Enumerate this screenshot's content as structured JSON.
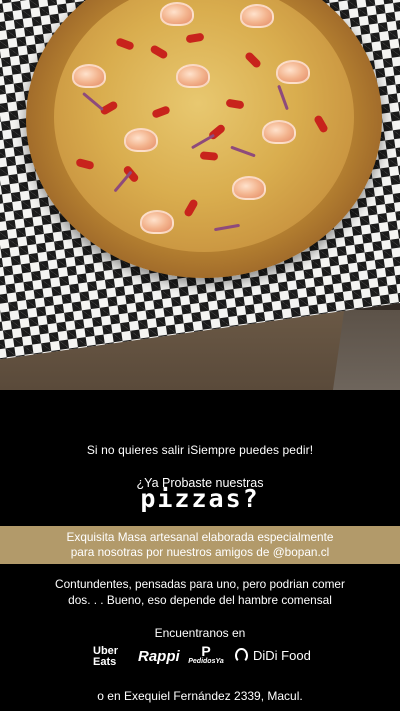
{
  "colors": {
    "background": "#000000",
    "band": "#b29a6a",
    "text": "#ffffff"
  },
  "photo": {
    "subject": "pizza-icon"
  },
  "text": {
    "line1": "Si no quieres salir iSiempre puedes pedir!",
    "line2": "¿Ya Probaste nuestras",
    "line3": "pizzas?",
    "band_line1": "Exquisita Masa artesanal elaborada especialmente",
    "band_line2": "para nosotras por nuestros amigos de @bopan.cl",
    "body_line1": "Contundentes, pensadas para uno, pero podrian comer",
    "body_line2": "dos. . . Bueno, eso depende del hambre comensal",
    "find_us": "Encuentranos en",
    "address": "o en Exequiel Fernández 2339, Macul."
  },
  "delivery": {
    "uber_line1": "Uber",
    "uber_line2": "Eats",
    "rappi": "Rappi",
    "pedidos_mark": "P",
    "pedidos_text": "PedidosYa",
    "didi": "DiDi Food"
  }
}
